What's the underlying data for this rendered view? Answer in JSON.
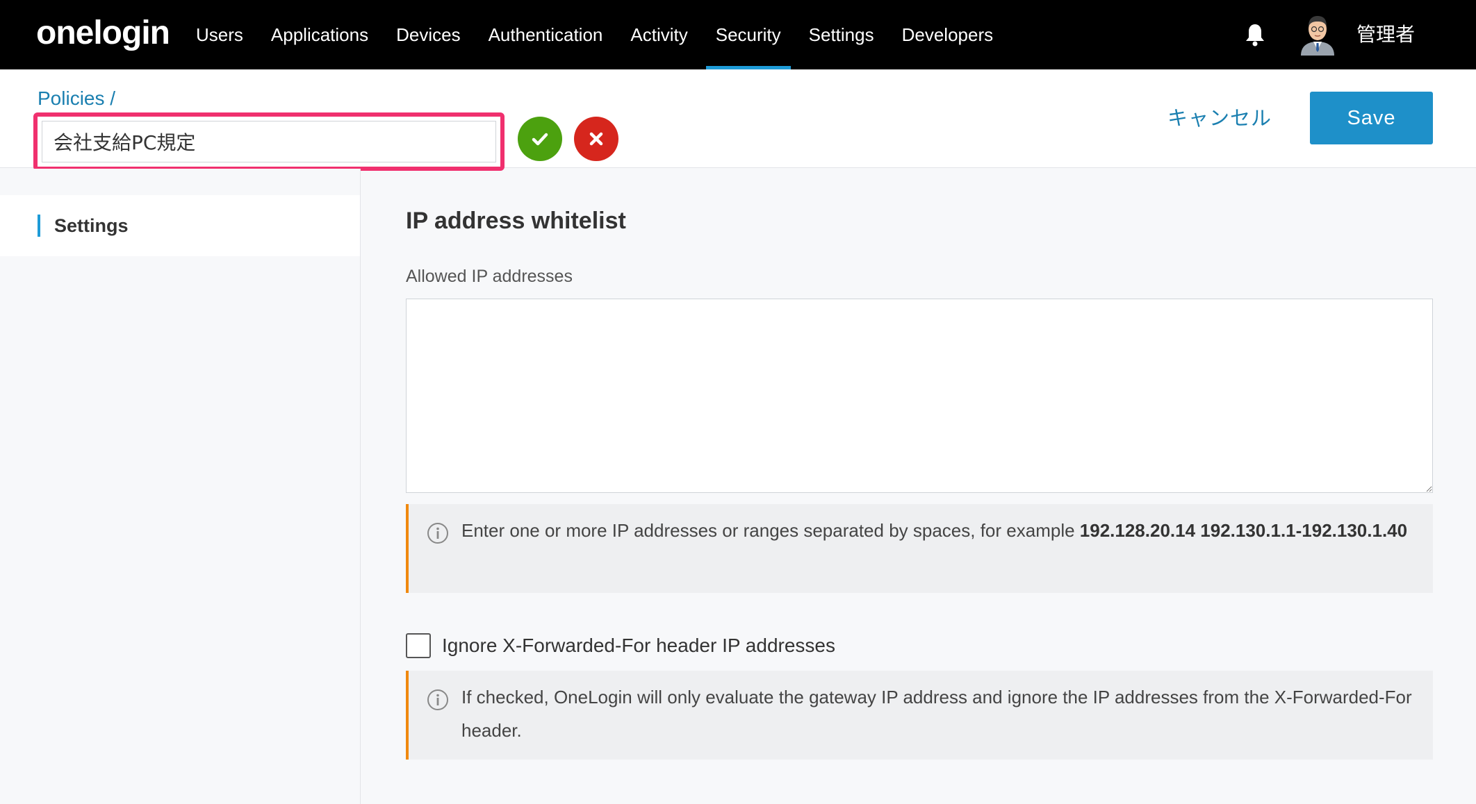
{
  "brand": {
    "logo": "onelogin"
  },
  "nav": {
    "items": [
      {
        "label": "Users"
      },
      {
        "label": "Applications"
      },
      {
        "label": "Devices"
      },
      {
        "label": "Authentication"
      },
      {
        "label": "Activity"
      },
      {
        "label": "Security",
        "active": true
      },
      {
        "label": "Settings"
      },
      {
        "label": "Developers"
      }
    ],
    "user_name": "管理者",
    "bell_icon": "bell-icon",
    "accent_color": "#1e9bd7"
  },
  "header": {
    "breadcrumb": "Policies /",
    "policy_name": "会社支給PC規定",
    "cancel_label": "キャンセル",
    "save_label": "Save",
    "highlight_color": "#f0306e"
  },
  "sidebar": {
    "items": [
      {
        "label": "Settings",
        "active": true
      }
    ]
  },
  "main": {
    "section_title": "IP address whitelist",
    "allowed_label": "Allowed IP addresses",
    "allowed_value": "",
    "info1": {
      "text": "Enter one or more IP addresses or ranges separated by spaces, for example ",
      "example": "192.128.20.14 192.130.1.1-192.130.1.40"
    },
    "ignore_xff": {
      "label": "Ignore X-Forwarded-For header IP addresses",
      "checked": false
    },
    "info2": {
      "text": "If checked, OneLogin will only evaluate the gateway IP address and ignore the IP addresses from the X-Forwarded-For header."
    }
  }
}
